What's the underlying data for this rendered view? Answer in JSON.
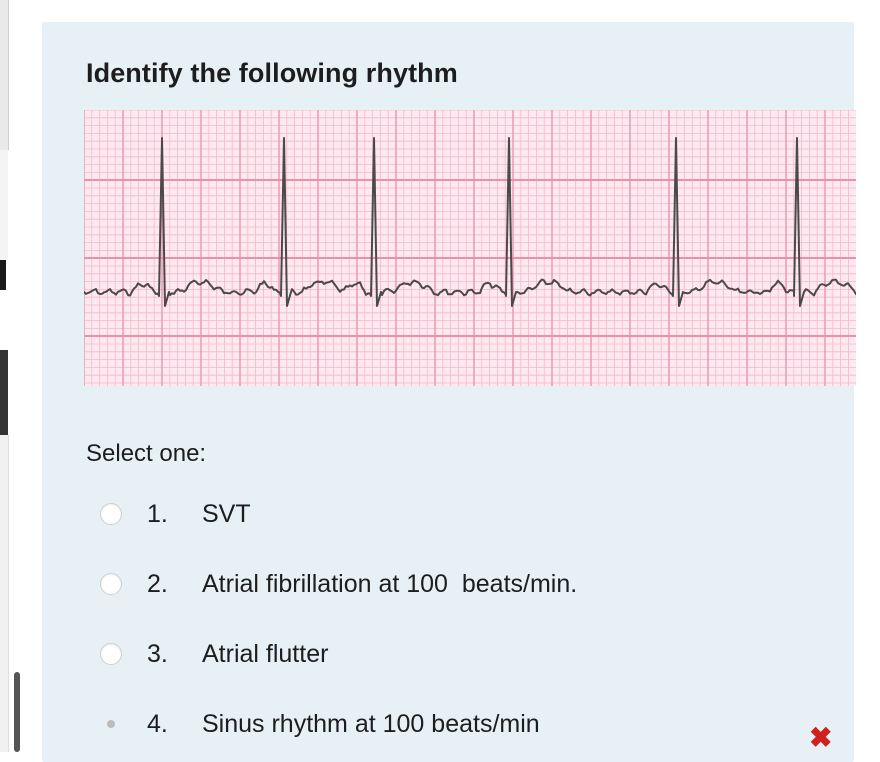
{
  "question": {
    "title": "Identify the following rhythm",
    "prompt": "Select one:",
    "options": [
      {
        "number": "1.",
        "text": "SVT",
        "selected": false
      },
      {
        "number": "2.",
        "text": "Atrial fibrillation at 100  beats/min.",
        "selected": false
      },
      {
        "number": "3.",
        "text": "Atrial flutter",
        "selected": false
      },
      {
        "number": "4.",
        "text": "Sinus rhythm at 100 beats/min",
        "selected": true
      }
    ],
    "feedback_icon": "incorrect-cross-icon",
    "feedback_symbol": "✖"
  },
  "ecg_strip": {
    "description_icon": "ecg-rhythm-strip",
    "grid_color": "#f2a0b8",
    "major_grid_color": "#e98aa6",
    "trace_color": "#4a4a4a"
  },
  "colors": {
    "panel_background": "#e7f1f5",
    "incorrect": "#d0201c"
  }
}
